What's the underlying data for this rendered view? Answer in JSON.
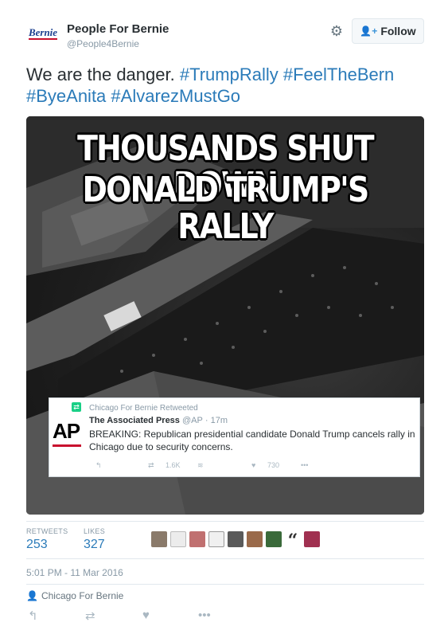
{
  "user": {
    "avatar_text": "Bernie",
    "name": "People For Bernie",
    "handle": "@People4Bernie"
  },
  "follow_label": "Follow",
  "tweet": {
    "text_plain": "We are the danger.",
    "hashtags": [
      "#TrumpRally",
      "#FeelTheBern",
      "#ByeAnita",
      "#AlvarezMustGo"
    ]
  },
  "media": {
    "meme_line1": "THOUSANDS SHUT DOWN",
    "meme_line2": "DONALD TRUMP'S RALLY",
    "embed": {
      "retweeted_by": "Chicago For Bernie Retweeted",
      "author_name": "The Associated Press",
      "author_handle": "@AP",
      "age": "17m",
      "logo_text": "AP",
      "body": "BREAKING: Republican presidential candidate Donald Trump cancels rally in Chicago due to security concerns.",
      "retweets": "1.6K",
      "likes": "730"
    }
  },
  "stats": {
    "retweets_label": "RETWEETS",
    "retweets_value": "253",
    "likes_label": "LIKES",
    "likes_value": "327"
  },
  "timestamp": "5:01 PM - 11 Mar 2016",
  "via": "Chicago For Bernie",
  "colors": {
    "link": "#2b7bb9",
    "retweet_green": "#19cf86",
    "ap_red": "#c8102e"
  }
}
